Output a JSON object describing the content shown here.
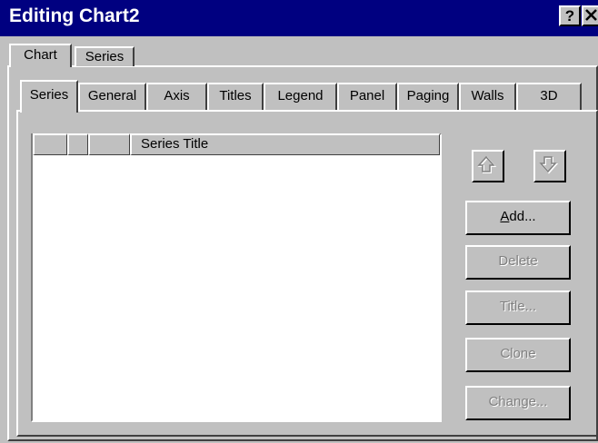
{
  "window": {
    "title": "Editing Chart2",
    "help_label": "?",
    "close_label": "x"
  },
  "outer_tabs": [
    {
      "label": "Chart",
      "selected": true
    },
    {
      "label": "Series",
      "selected": false
    }
  ],
  "inner_tabs": [
    {
      "label": "Series",
      "selected": true
    },
    {
      "label": "General"
    },
    {
      "label": "Axis"
    },
    {
      "label": "Titles"
    },
    {
      "label": "Legend"
    },
    {
      "label": "Panel"
    },
    {
      "label": "Paging"
    },
    {
      "label": "Walls"
    },
    {
      "label": "3D"
    }
  ],
  "series_list": {
    "header": {
      "title_column": "Series Title"
    }
  },
  "buttons": {
    "add": {
      "label_first": "A",
      "label_rest": "dd...",
      "enabled": true
    },
    "delete": {
      "label": "Delete",
      "enabled": false
    },
    "title": {
      "label": "Title...",
      "enabled": false
    },
    "clone": {
      "label": "Clone",
      "enabled": false
    },
    "change": {
      "label": "Change...",
      "enabled": false
    }
  },
  "icons": {
    "move_up": "arrow-up-icon",
    "move_down": "arrow-down-icon"
  }
}
